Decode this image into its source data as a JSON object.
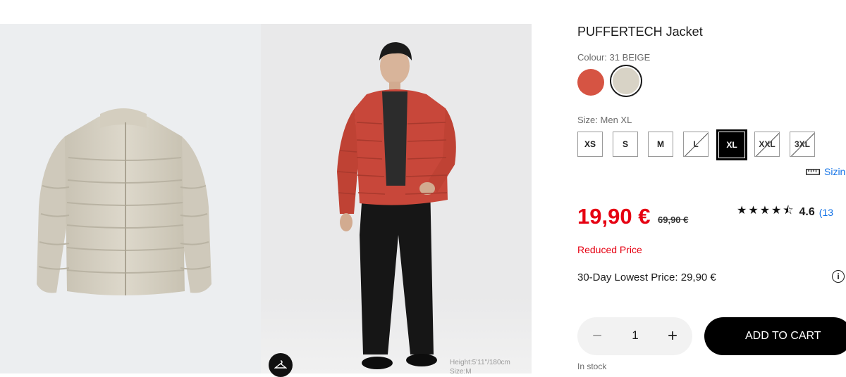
{
  "gallery": {
    "model_caption_line1": "Height:5'11\"/180cm",
    "model_caption_line2": "Size:M",
    "hanger_icon": "hanger-icon"
  },
  "product": {
    "title": "PUFFERTECH Jacket",
    "colour_label": "Colour: 31 BEIGE",
    "colours": [
      {
        "name": "red",
        "hex": "#d65443"
      },
      {
        "name": "beige",
        "hex": "#d8d3c6",
        "selected": true
      }
    ],
    "size_label": "Size: Men XL",
    "sizes": [
      {
        "label": "XS",
        "available": true
      },
      {
        "label": "S",
        "available": true
      },
      {
        "label": "M",
        "available": true
      },
      {
        "label": "L",
        "available": false
      },
      {
        "label": "XL",
        "available": true,
        "selected": true
      },
      {
        "label": "XXL",
        "available": false
      },
      {
        "label": "3XL",
        "available": false
      }
    ],
    "sizing_link": "Sizin",
    "sizing_icon": "ruler-icon",
    "price": "19,90 €",
    "old_price": "69,90 €",
    "rating_stars": "★★★★⯪",
    "rating_value": "4.6",
    "rating_count": "(13",
    "reduced_label": "Reduced Price",
    "lowest_price_label": "30-Day Lowest Price: 29,90 €",
    "info_icon": "info-icon",
    "quantity": "1",
    "add_to_cart": "ADD TO CART",
    "stock_status": "In stock"
  },
  "colors": {
    "sale_red": "#e60012",
    "link_blue": "#1473e6",
    "black": "#000000"
  }
}
